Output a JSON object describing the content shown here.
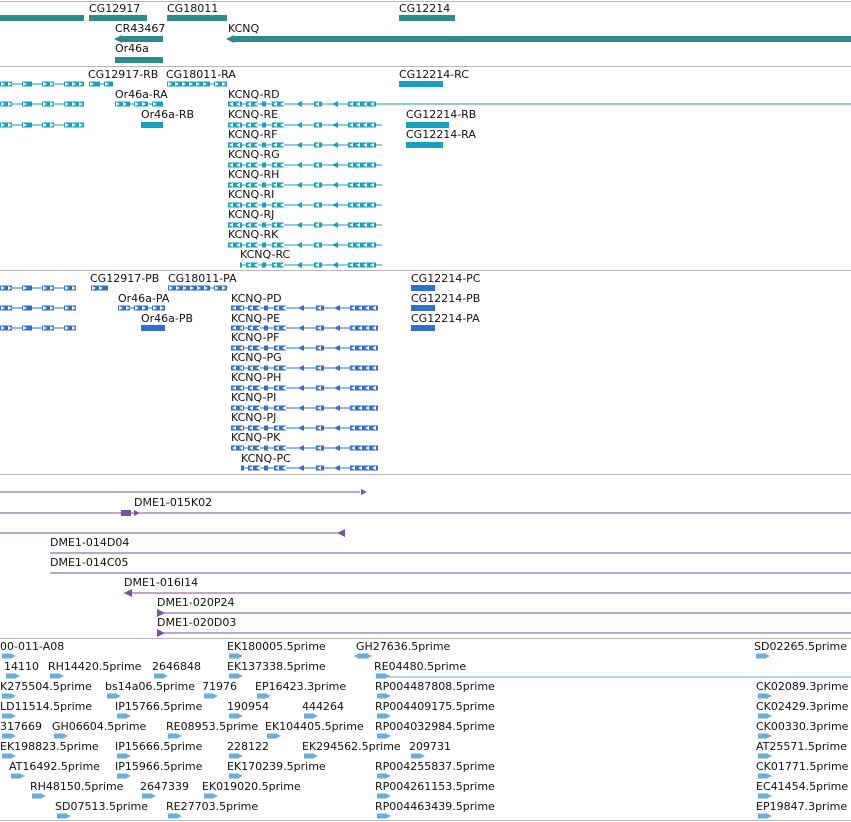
{
  "colors": {
    "gene": "#2e8b8b",
    "mrna": "#17a0c0",
    "protein": "#2f6fd0",
    "clone": "#7b4fa6",
    "est": "#6aaedb",
    "divider": "#b8b8b8"
  },
  "tracks": {
    "genes": [
      {
        "label": "CG12917",
        "dir": "plus"
      },
      {
        "label": "CG18011",
        "dir": "plus"
      },
      {
        "label": "CG12214",
        "dir": "plus"
      },
      {
        "label": "CR43467",
        "dir": "minus"
      },
      {
        "label": "KCNQ",
        "dir": "minus"
      },
      {
        "label": "Or46a",
        "dir": "plus"
      }
    ],
    "transcripts": [
      "CG12917-RB",
      "CG18011-RA",
      "CG12214-RC",
      "Or46a-RA",
      "KCNQ-RD",
      "Or46a-RB",
      "KCNQ-RE",
      "CG12214-RB",
      "KCNQ-RF",
      "CG12214-RA",
      "KCNQ-RG",
      "KCNQ-RH",
      "KCNQ-RI",
      "KCNQ-RJ",
      "KCNQ-RK",
      "KCNQ-RC"
    ],
    "proteins": [
      "CG12917-PB",
      "CG18011-PA",
      "CG12214-PC",
      "Or46a-PA",
      "KCNQ-PD",
      "CG12214-PB",
      "Or46a-PB",
      "KCNQ-PE",
      "CG12214-PA",
      "KCNQ-PF",
      "KCNQ-PG",
      "KCNQ-PH",
      "KCNQ-PI",
      "KCNQ-PJ",
      "KCNQ-PK",
      "KCNQ-PC"
    ],
    "clones": [
      "DME1-015K02",
      "DME1-014D04",
      "DME1-014C05",
      "DME1-016I14",
      "DME1-020P24",
      "DME1-020D03"
    ],
    "ests": [
      "00-011-A08",
      "EK180005.5prime",
      "GH27636.5prime",
      "SD02265.5prime",
      "14110",
      "RH14420.5prime",
      "2646848",
      "EK137338.5prime",
      "RE04480.5prime",
      "K275504.5prime",
      "bs14a06.5prime",
      "71976",
      "EP16423.3prime",
      "RP004487808.5prime",
      "CK02089.3prime",
      "LD11514.5prime",
      "IP15766.5prime",
      "190954",
      "444264",
      "RP004409175.5prime",
      "CK02429.3prime",
      "317669",
      "GH06604.5prime",
      "RE08953.5prime",
      "EK104405.5prime",
      "RP004032984.5prime",
      "CK00330.3prime",
      "EK198823.5prime",
      "IP15666.5prime",
      "228122",
      "EK294562.5prime",
      "209731",
      "AT25571.5prime",
      "AT16492.5prime",
      "IP15966.5prime",
      "EK170239.5prime",
      "RP004255837.5prime",
      "CK01771.5prime",
      "RH48150.5prime",
      "2647339",
      "EK019020.5prime",
      "RP004261153.5prime",
      "EC41454.5prime",
      "SD07513.5prime",
      "RE27703.5prime",
      "RP004463439.5prime",
      "EP19847.3prime"
    ]
  }
}
